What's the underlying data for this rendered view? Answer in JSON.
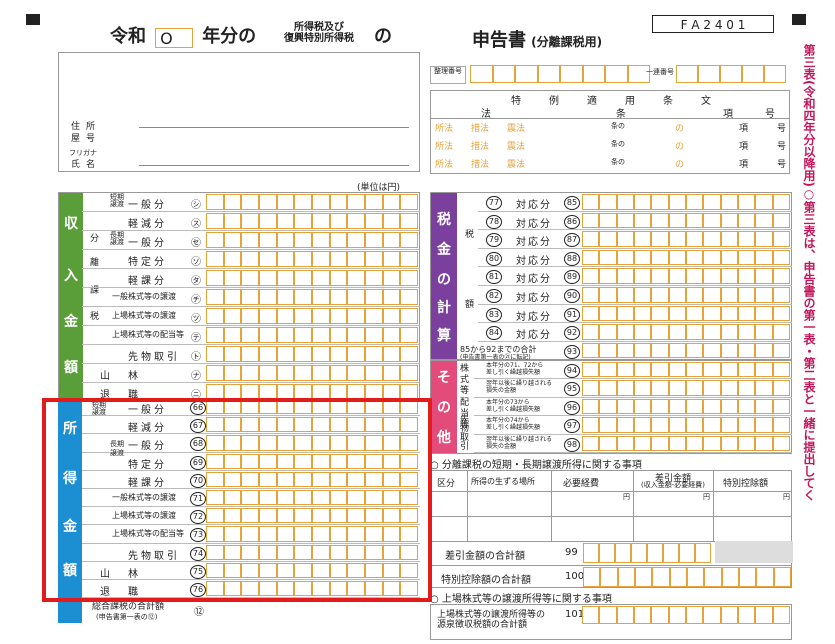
{
  "header": {
    "era": "令和",
    "year_value": "O",
    "year_suffix": "年分の",
    "tax_name_line1": "所得税及び",
    "tax_name_line2": "復興特別所得税",
    "no": "の",
    "title": "申告書",
    "title_sub": "(分離課税用)",
    "form_code": "F A 2 4 0 1"
  },
  "id_section": {
    "address_label": "住所",
    "yago_label": "屋号",
    "furigana_label": "フリガナ",
    "name_label": "氏名",
    "seiri_label": "整理番号",
    "renban_label": "一連番号"
  },
  "law_table": {
    "header_main": "特例適用条文",
    "cols": [
      "法",
      "条",
      "項",
      "号"
    ],
    "rows": [
      {
        "items": [
          "所法",
          "措法",
          "震法"
        ],
        "jou": "条の",
        "no": "の",
        "kou": "項",
        "gou": "号"
      },
      {
        "items": [
          "所法",
          "措法",
          "震法"
        ],
        "jou": "条の",
        "no": "の",
        "kou": "項",
        "gou": "号"
      },
      {
        "items": [
          "所法",
          "措法",
          "震法"
        ],
        "jou": "条の",
        "no": "の",
        "kou": "項",
        "gou": "号"
      }
    ]
  },
  "unit_label": "(単位は円)",
  "side_text": "第三表(令和四年分以降用)○第三表は、申告書の第一表・第二表と一緒に提出してく",
  "income_section": {
    "group_label": [
      "収",
      "入",
      "金",
      "額"
    ],
    "sub_bun": "分",
    "sub_ri": "離",
    "sub_ka": "課",
    "sub_zei": "税",
    "rows": [
      {
        "cat": "短期譲渡",
        "label": "一般分",
        "mark": "㋛"
      },
      {
        "cat": "",
        "label": "軽減分",
        "mark": "㋜"
      },
      {
        "cat": "長期譲渡",
        "label": "一般分",
        "mark": "㋝"
      },
      {
        "cat": "",
        "label": "特定分",
        "mark": "㋞"
      },
      {
        "cat": "",
        "label": "軽課分",
        "mark": "㋟"
      },
      {
        "cat": "",
        "label": "一般株式等の譲渡",
        "mark": "㋠"
      },
      {
        "cat": "",
        "label": "上場株式等の譲渡",
        "mark": "㋡"
      },
      {
        "cat": "",
        "label": "上場株式等の配当等",
        "mark": "㋢"
      },
      {
        "cat": "",
        "label": "先物取引",
        "mark": "㋣"
      },
      {
        "cat": "",
        "label": "山林",
        "mark": "㋤"
      },
      {
        "cat": "",
        "label": "退職",
        "mark": "㋥"
      }
    ]
  },
  "shotoku_section": {
    "group_label": [
      "所",
      "得",
      "金",
      "額"
    ],
    "rows": [
      {
        "label": "一般分",
        "mark": "66"
      },
      {
        "label": "軽減分",
        "mark": "67"
      },
      {
        "label": "一般分",
        "mark": "68"
      },
      {
        "label": "特定分",
        "mark": "69"
      },
      {
        "label": "軽課分",
        "mark": "70"
      },
      {
        "label": "一般株式等の譲渡",
        "mark": "71"
      },
      {
        "label": "上場株式等の譲渡",
        "mark": "72"
      },
      {
        "label": "上場株式等の配当等",
        "mark": "73"
      },
      {
        "label": "先物取引",
        "mark": "74"
      },
      {
        "label": "山林",
        "mark": "75"
      },
      {
        "label": "退職",
        "mark": "76"
      }
    ],
    "footer_label": "総合課税の合計額",
    "footer_sub": "(申告書第一表の⑫)",
    "footer_mark": "⑫"
  },
  "tax_section": {
    "group_label": [
      "税",
      "金",
      "の",
      "計",
      "算"
    ],
    "sub_zei": "税",
    "sub_gaku": "額",
    "rows": [
      {
        "code": "77",
        "label": "対応分",
        "mark": "85"
      },
      {
        "code": "78",
        "label": "対応分",
        "mark": "86"
      },
      {
        "code": "79",
        "label": "対応分",
        "mark": "87"
      },
      {
        "code": "80",
        "label": "対応分",
        "mark": "88"
      },
      {
        "code": "81",
        "label": "対応分",
        "mark": "89"
      },
      {
        "code": "82",
        "label": "対応分",
        "mark": "90"
      },
      {
        "code": "83",
        "label": "対応分",
        "mark": "91"
      },
      {
        "code": "84",
        "label": "対応分",
        "mark": "92"
      }
    ],
    "total_label": "85から92までの合計",
    "total_sub": "(申告書第一表の㉑に転記)",
    "total_mark": "93"
  },
  "other_section": {
    "group_label": [
      "そ",
      "の",
      "他"
    ],
    "rows": [
      {
        "cat": "株式等",
        "label1": "本年分の71、72から",
        "label2": "差し引く繰越損失額",
        "mark": "94"
      },
      {
        "cat": "",
        "label1": "翌年以後に繰り越される",
        "label2": "損失の金額",
        "mark": "95"
      },
      {
        "cat": "配当等",
        "label1": "本年分の73から",
        "label2": "差し引く繰越損失額",
        "mark": "96"
      },
      {
        "cat": "先物取引",
        "label1": "本年分の74から",
        "label2": "差し引く繰越損失額",
        "mark": "97"
      },
      {
        "cat": "",
        "label1": "翌年以後に繰り越される",
        "label2": "損失の金額",
        "mark": "98"
      }
    ]
  },
  "bunri_section": {
    "title": "○ 分離課税の短期・長期譲渡所得に関する事項",
    "cols": [
      "区分",
      "所得の生ずる場所",
      "必要経費",
      "差引金額",
      "(収入金額-必要経費)",
      "特別控除額"
    ],
    "yen": "円",
    "total1_label": "差引金額の合計額",
    "total1_mark": "99",
    "total2_label": "特別控除額の合計額",
    "total2_mark": "100"
  },
  "listed_section": {
    "title": "○ 上場株式等の譲渡所得等に関する事項",
    "row_label1": "上場株式等の譲渡所得等の",
    "row_label2": "源泉徴収税額の合計額",
    "row_mark": "101"
  }
}
